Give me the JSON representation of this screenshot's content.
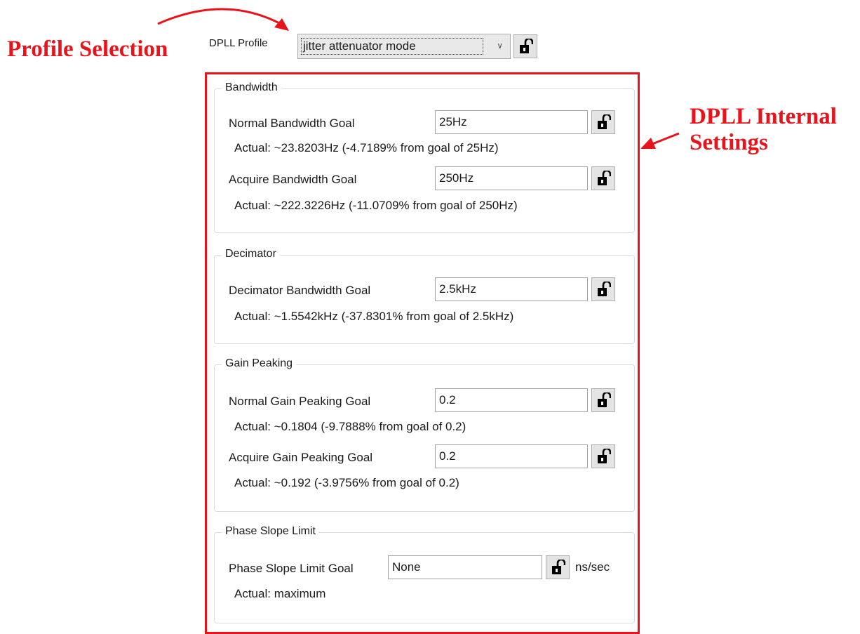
{
  "annotations": {
    "profile_selection": "Profile Selection",
    "dpll_internal_settings": "DPLL Internal Settings"
  },
  "profile": {
    "label": "DPLL Profile",
    "selected": "jitter attenuator mode"
  },
  "bandwidth": {
    "title": "Bandwidth",
    "normal_label": "Normal Bandwidth Goal",
    "normal_value": "25Hz",
    "normal_actual": "Actual:  ~23.8203Hz (-4.7189% from goal of 25Hz)",
    "acquire_label": "Acquire Bandwidth Goal",
    "acquire_value": "250Hz",
    "acquire_actual": "Actual:  ~222.3226Hz (-11.0709% from goal of 250Hz)"
  },
  "decimator": {
    "title": "Decimator",
    "label": "Decimator Bandwidth Goal",
    "value": "2.5kHz",
    "actual": "Actual:  ~1.5542kHz (-37.8301% from goal of 2.5kHz)"
  },
  "gain_peaking": {
    "title": "Gain Peaking",
    "normal_label": "Normal Gain Peaking Goal",
    "normal_value": "0.2",
    "normal_actual": "Actual:  ~0.1804 (-9.7888% from goal of 0.2)",
    "acquire_label": "Acquire Gain Peaking Goal",
    "acquire_value": "0.2",
    "acquire_actual": "Actual:  ~0.192 (-3.9756% from goal of 0.2)"
  },
  "phase_slope": {
    "title": "Phase Slope Limit",
    "label": "Phase Slope Limit Goal",
    "value": "None",
    "units": "ns/sec",
    "actual": "Actual:  maximum"
  },
  "icons": {
    "lock": "unlocked-padlock-icon",
    "dropdown": "chevron-down-icon"
  },
  "colors": {
    "annotation": "#e8141b",
    "group_border": "#d5dfe5"
  }
}
